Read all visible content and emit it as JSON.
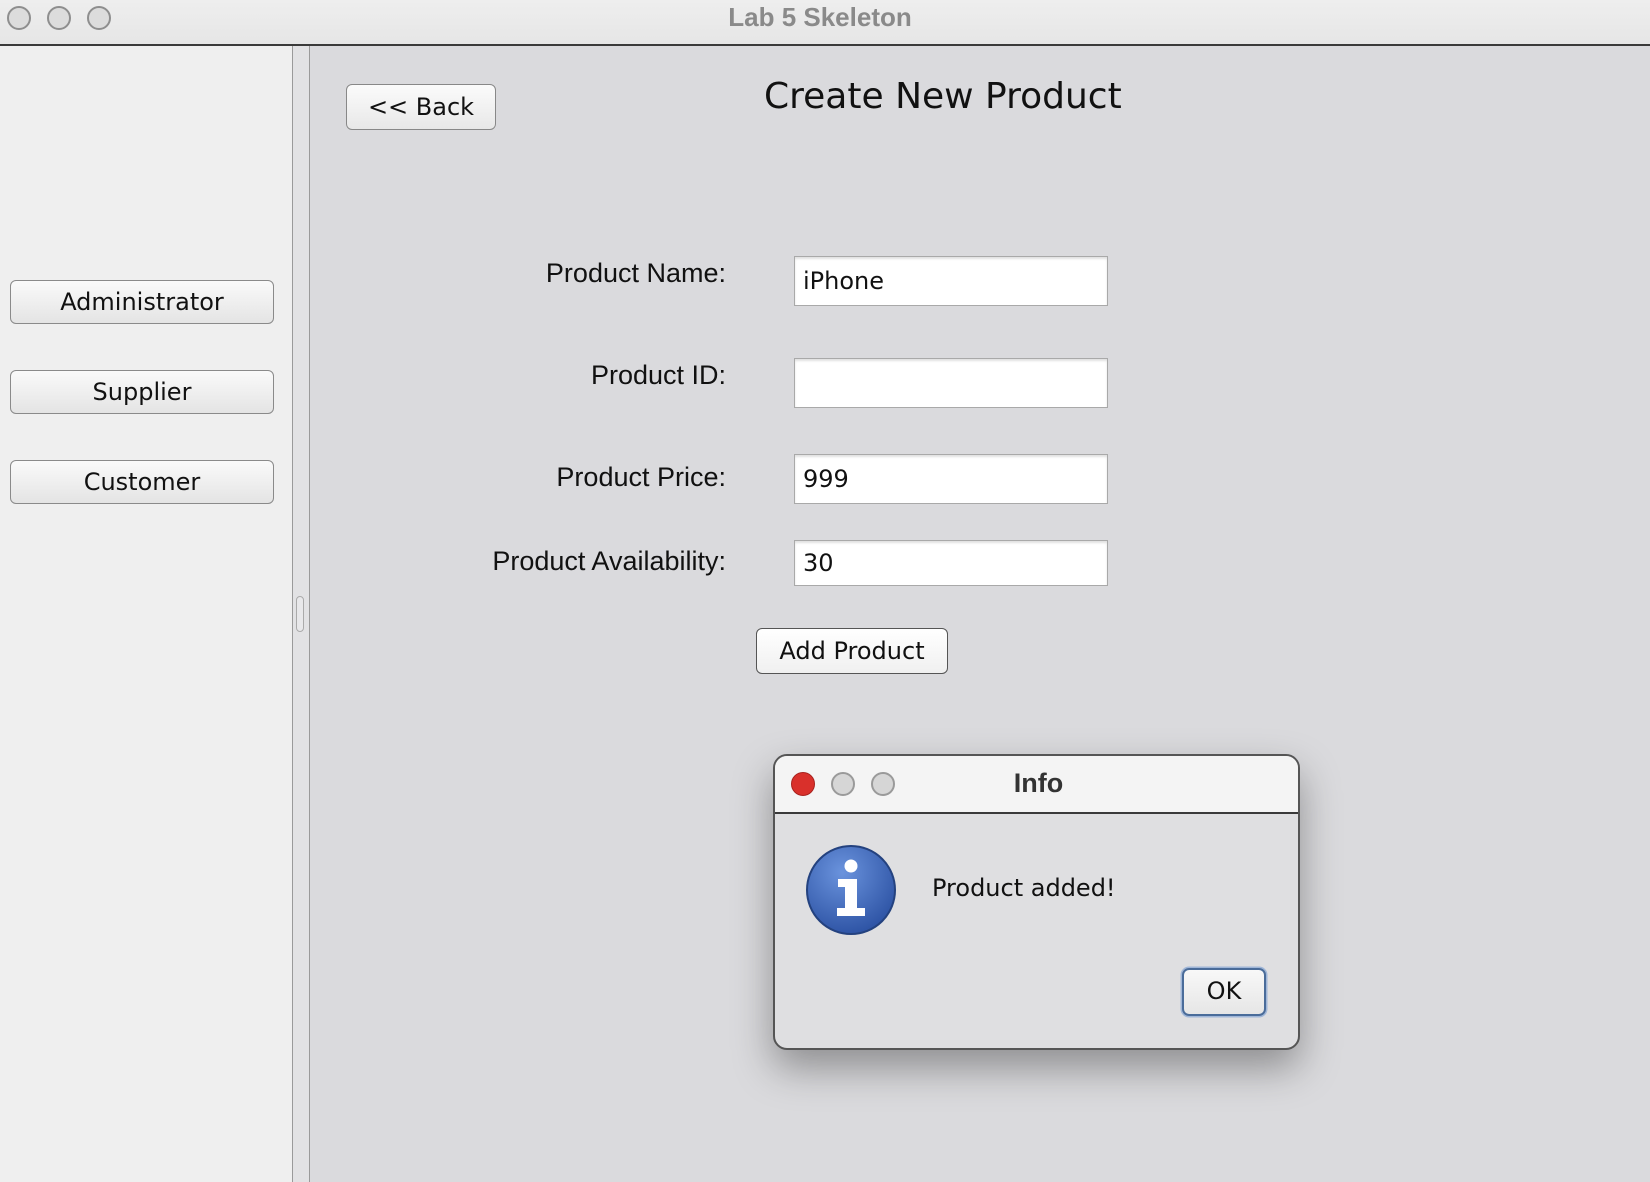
{
  "window": {
    "title": "Lab 5 Skeleton"
  },
  "sidebar": {
    "buttons": [
      {
        "label": "Administrator"
      },
      {
        "label": "Supplier"
      },
      {
        "label": "Customer"
      }
    ]
  },
  "main": {
    "back_label": "<< Back",
    "title": "Create New Product",
    "fields": {
      "name": {
        "label": "Product Name:",
        "value": "iPhone"
      },
      "id": {
        "label": "Product ID:",
        "value": ""
      },
      "price": {
        "label": "Product Price:",
        "value": "999"
      },
      "availability": {
        "label": "Product Availability:",
        "value": "30"
      }
    },
    "add_label": "Add Product"
  },
  "dialog": {
    "title": "Info",
    "message": "Product added!",
    "ok_label": "OK",
    "icon": "info-icon",
    "colors": {
      "close": "#d9302b",
      "icon_blue": "#3b63b5"
    }
  }
}
